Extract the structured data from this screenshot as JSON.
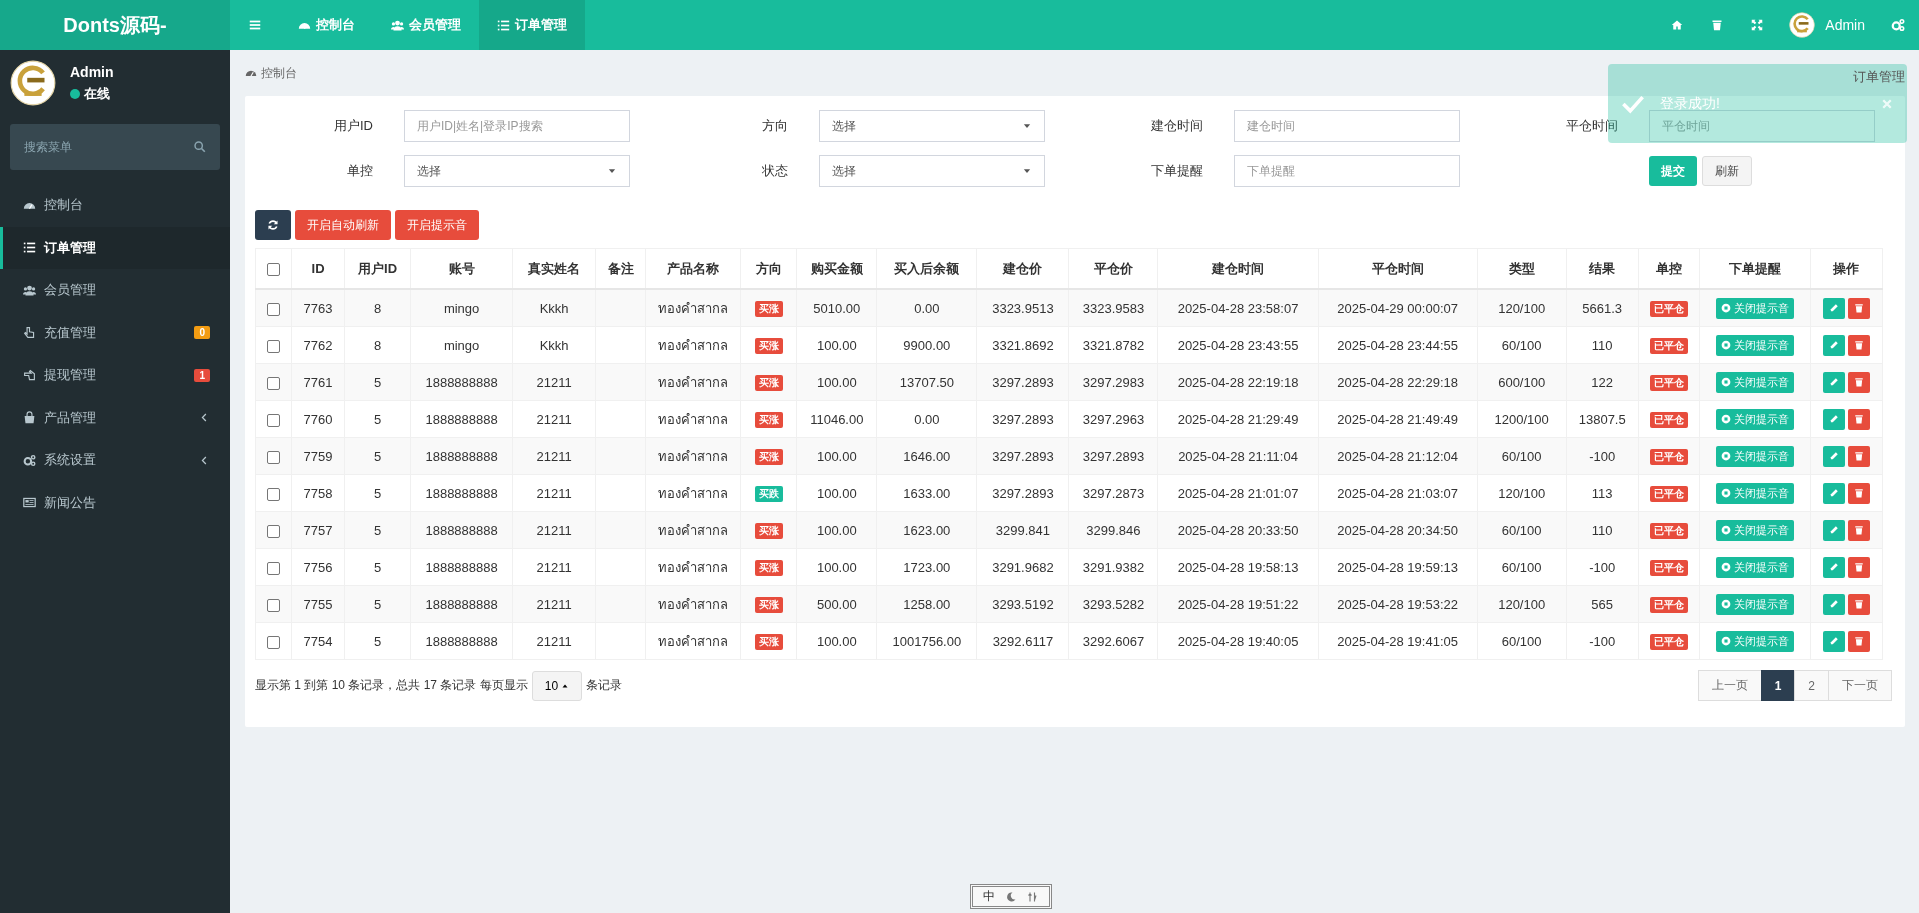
{
  "header": {
    "brand": "Donts源码-",
    "nav": [
      {
        "label": "控制台",
        "selected": false
      },
      {
        "label": "会员管理",
        "selected": false
      },
      {
        "label": "订单管理",
        "selected": true
      }
    ],
    "user": "Admin"
  },
  "sidebar": {
    "user": {
      "name": "Admin",
      "status": "在线"
    },
    "search": {
      "placeholder": "搜索菜单"
    },
    "items": [
      {
        "label": "控制台",
        "selected": false,
        "kind": "link"
      },
      {
        "label": "订单管理",
        "selected": true,
        "kind": "link"
      },
      {
        "label": "会员管理",
        "selected": false,
        "kind": "link"
      },
      {
        "label": "充值管理",
        "selected": false,
        "kind": "link",
        "badge": "0",
        "color": "#f39c12"
      },
      {
        "label": "提现管理",
        "selected": false,
        "kind": "link",
        "badge": "1",
        "color": "#e74c3c"
      },
      {
        "label": "产品管理",
        "selected": false,
        "kind": "submenu"
      },
      {
        "label": "系统设置",
        "selected": false,
        "kind": "submenu"
      },
      {
        "label": "新闻公告",
        "selected": false,
        "kind": "link"
      }
    ]
  },
  "breadcrumb": "控制台",
  "page_tab": "订单管理",
  "toast": {
    "message": "登录成功!"
  },
  "filters": [
    {
      "label": "用户ID",
      "kind": "text",
      "placeholder": "用户ID|姓名|登录IP搜索"
    },
    {
      "label": "方向",
      "kind": "select",
      "value": "选择"
    },
    {
      "label": "建仓时间",
      "kind": "text",
      "placeholder": "建仓时间"
    },
    {
      "label": "平仓时间",
      "kind": "text",
      "placeholder": "平仓时间"
    },
    {
      "label": "单控",
      "kind": "select",
      "value": "选择"
    },
    {
      "label": "状态",
      "kind": "select",
      "value": "选择"
    },
    {
      "label": "下单提醒",
      "kind": "text",
      "placeholder": "下单提醒"
    }
  ],
  "filter_buttons": [
    "提交",
    "刷新"
  ],
  "toolbar": [
    "开启自动刷新",
    "开启提示音"
  ],
  "table": {
    "header_checked": false,
    "columns": [
      "ID",
      "用户ID",
      "账号",
      "真实姓名",
      "备注",
      "产品名称",
      "方向",
      "购买金额",
      "买入后余额",
      "建仓价",
      "平仓价",
      "建仓时间",
      "平仓时间",
      "类型",
      "结果",
      "单控",
      "下单提醒",
      "操作"
    ],
    "rows": [
      {
        "checked": false,
        "id": "7763",
        "user_id": "8",
        "account": "mingo",
        "real_name": "Kkkh",
        "product": "ทองคำสากล",
        "direction": {
          "label": "买涨",
          "color": "#e74c3c"
        },
        "amount": "5010.00",
        "balance": "0.00",
        "open_price": "3323.9513",
        "close_price": "3323.9583",
        "open_time": "2025-04-28 23:58:07",
        "close_time": "2025-04-29 00:00:07",
        "type": "120/100",
        "result": "5661.3",
        "control": "已平仓",
        "reminder": "关闭提示音"
      },
      {
        "checked": false,
        "id": "7762",
        "user_id": "8",
        "account": "mingo",
        "real_name": "Kkkh",
        "product": "ทองคำสากล",
        "direction": {
          "label": "买涨",
          "color": "#e74c3c"
        },
        "amount": "100.00",
        "balance": "9900.00",
        "open_price": "3321.8692",
        "close_price": "3321.8782",
        "open_time": "2025-04-28 23:43:55",
        "close_time": "2025-04-28 23:44:55",
        "type": "60/100",
        "result": "110",
        "control": "已平仓",
        "reminder": "关闭提示音"
      },
      {
        "checked": false,
        "id": "7761",
        "user_id": "5",
        "account": "1888888888",
        "real_name": "21211",
        "product": "ทองคำสากล",
        "direction": {
          "label": "买涨",
          "color": "#e74c3c"
        },
        "amount": "100.00",
        "balance": "13707.50",
        "open_price": "3297.2893",
        "close_price": "3297.2983",
        "open_time": "2025-04-28 22:19:18",
        "close_time": "2025-04-28 22:29:18",
        "type": "600/100",
        "result": "122",
        "control": "已平仓",
        "reminder": "关闭提示音"
      },
      {
        "checked": false,
        "id": "7760",
        "user_id": "5",
        "account": "1888888888",
        "real_name": "21211",
        "product": "ทองคำสากล",
        "direction": {
          "label": "买涨",
          "color": "#e74c3c"
        },
        "amount": "11046.00",
        "balance": "0.00",
        "open_price": "3297.2893",
        "close_price": "3297.2963",
        "open_time": "2025-04-28 21:29:49",
        "close_time": "2025-04-28 21:49:49",
        "type": "1200/100",
        "result": "13807.5",
        "control": "已平仓",
        "reminder": "关闭提示音"
      },
      {
        "checked": false,
        "id": "7759",
        "user_id": "5",
        "account": "1888888888",
        "real_name": "21211",
        "product": "ทองคำสากล",
        "direction": {
          "label": "买涨",
          "color": "#e74c3c"
        },
        "amount": "100.00",
        "balance": "1646.00",
        "open_price": "3297.2893",
        "close_price": "3297.2893",
        "open_time": "2025-04-28 21:11:04",
        "close_time": "2025-04-28 21:12:04",
        "type": "60/100",
        "result": "-100",
        "control": "已平仓",
        "reminder": "关闭提示音"
      },
      {
        "checked": false,
        "id": "7758",
        "user_id": "5",
        "account": "1888888888",
        "real_name": "21211",
        "product": "ทองคำสากล",
        "direction": {
          "label": "买跌",
          "color": "#18bc9c"
        },
        "amount": "100.00",
        "balance": "1633.00",
        "open_price": "3297.2893",
        "close_price": "3297.2873",
        "open_time": "2025-04-28 21:01:07",
        "close_time": "2025-04-28 21:03:07",
        "type": "120/100",
        "result": "113",
        "control": "已平仓",
        "reminder": "关闭提示音"
      },
      {
        "checked": false,
        "id": "7757",
        "user_id": "5",
        "account": "1888888888",
        "real_name": "21211",
        "product": "ทองคำสากล",
        "direction": {
          "label": "买涨",
          "color": "#e74c3c"
        },
        "amount": "100.00",
        "balance": "1623.00",
        "open_price": "3299.841",
        "close_price": "3299.846",
        "open_time": "2025-04-28 20:33:50",
        "close_time": "2025-04-28 20:34:50",
        "type": "60/100",
        "result": "110",
        "control": "已平仓",
        "reminder": "关闭提示音"
      },
      {
        "checked": false,
        "id": "7756",
        "user_id": "5",
        "account": "1888888888",
        "real_name": "21211",
        "product": "ทองคำสากล",
        "direction": {
          "label": "买涨",
          "color": "#e74c3c"
        },
        "amount": "100.00",
        "balance": "1723.00",
        "open_price": "3291.9682",
        "close_price": "3291.9382",
        "open_time": "2025-04-28 19:58:13",
        "close_time": "2025-04-28 19:59:13",
        "type": "60/100",
        "result": "-100",
        "control": "已平仓",
        "reminder": "关闭提示音"
      },
      {
        "checked": false,
        "id": "7755",
        "user_id": "5",
        "account": "1888888888",
        "real_name": "21211",
        "product": "ทองคำสากล",
        "direction": {
          "label": "买涨",
          "color": "#e74c3c"
        },
        "amount": "500.00",
        "balance": "1258.00",
        "open_price": "3293.5192",
        "close_price": "3293.5282",
        "open_time": "2025-04-28 19:51:22",
        "close_time": "2025-04-28 19:53:22",
        "type": "120/100",
        "result": "565",
        "control": "已平仓",
        "reminder": "关闭提示音"
      },
      {
        "checked": false,
        "id": "7754",
        "user_id": "5",
        "account": "1888888888",
        "real_name": "21211",
        "product": "ทองคำสากล",
        "direction": {
          "label": "买涨",
          "color": "#e74c3c"
        },
        "amount": "100.00",
        "balance": "1001756.00",
        "open_price": "3292.6117",
        "close_price": "3292.6067",
        "open_time": "2025-04-28 19:40:05",
        "close_time": "2025-04-28 19:41:05",
        "type": "60/100",
        "result": "-100",
        "control": "已平仓",
        "reminder": "关闭提示音"
      }
    ]
  },
  "pagination": {
    "info": "显示第 1 到第 10 条记录，总共 17 条记录 每页显示",
    "page_size": "10",
    "suffix": "条记录",
    "pages": [
      {
        "label": "上一页",
        "selected": false
      },
      {
        "label": "1",
        "selected": true
      },
      {
        "label": "2",
        "selected": false
      },
      {
        "label": "下一页",
        "selected": false
      }
    ]
  },
  "ime": {
    "label": "中"
  }
}
